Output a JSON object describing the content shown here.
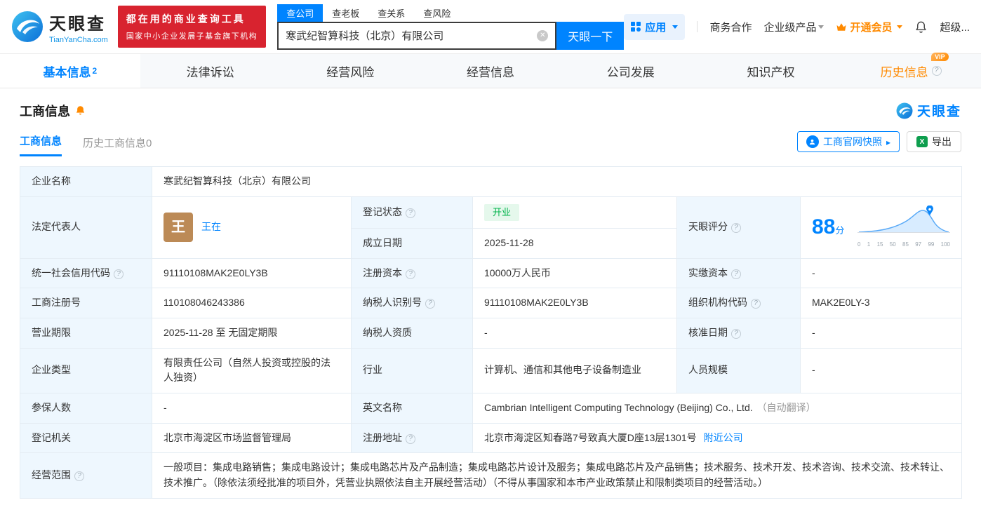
{
  "colors": {
    "primary": "#0084ff",
    "vip_orange": "#ff8a00",
    "promo_red": "#d8232f",
    "status_green": "#00b34a",
    "label_cell_bg": "#eef7fe"
  },
  "header": {
    "logo": {
      "name": "天眼查",
      "domain": "TianYanCha.com"
    },
    "promo": {
      "line1": "都在用的商业查询工具",
      "line2": "国家中小企业发展子基金旗下机构"
    },
    "search": {
      "tabs": [
        {
          "label": "查公司",
          "active": true
        },
        {
          "label": "查老板",
          "active": false
        },
        {
          "label": "查关系",
          "active": false
        },
        {
          "label": "查风险",
          "active": false
        }
      ],
      "value": "寒武纪智算科技（北京）有限公司",
      "button": "天眼一下"
    },
    "nav": {
      "apps": "应用",
      "business": "商务合作",
      "enterprise": "企业级产品",
      "vip": "开通会员",
      "more": "超级..."
    }
  },
  "tabs": [
    {
      "label": "基本信息",
      "badge": "2",
      "active": true
    },
    {
      "label": "法律诉讼",
      "active": false
    },
    {
      "label": "经营风险",
      "active": false
    },
    {
      "label": "经营信息",
      "active": false
    },
    {
      "label": "公司发展",
      "active": false
    },
    {
      "label": "知识产权",
      "active": false
    },
    {
      "label": "历史信息",
      "vip": "VIP",
      "help": true,
      "active": false
    }
  ],
  "section": {
    "title": "工商信息",
    "brand": "天眼查",
    "subtabs": [
      {
        "label": "工商信息",
        "active": true
      },
      {
        "label": "历史工商信息",
        "count": "0",
        "active": false
      }
    ],
    "snapshot_button": "工商官网快照",
    "export_button": "导出"
  },
  "fields": {
    "company_name": {
      "label": "企业名称",
      "value": "寒武纪智算科技（北京）有限公司"
    },
    "legal_rep": {
      "label": "法定代表人",
      "avatar": "王",
      "value": "王在"
    },
    "reg_status": {
      "label": "登记状态",
      "value": "开业"
    },
    "establish_date": {
      "label": "成立日期",
      "value": "2025-11-28"
    },
    "tyc_score": {
      "label": "天眼评分"
    },
    "credit_code": {
      "label": "统一社会信用代码",
      "value": "91110108MAK2E0LY3B"
    },
    "reg_capital": {
      "label": "注册资本",
      "value": "10000万人民币"
    },
    "paid_capital": {
      "label": "实缴资本",
      "value": "-"
    },
    "reg_number": {
      "label": "工商注册号",
      "value": "110108046243386"
    },
    "taxpayer_id": {
      "label": "纳税人识别号",
      "value": "91110108MAK2E0LY3B"
    },
    "org_code": {
      "label": "组织机构代码",
      "value": "MAK2E0LY-3"
    },
    "business_term": {
      "label": "营业期限",
      "value": "2025-11-28 至 无固定期限"
    },
    "taxpayer_qualification": {
      "label": "纳税人资质",
      "value": "-"
    },
    "approval_date": {
      "label": "核准日期",
      "value": "-"
    },
    "company_type": {
      "label": "企业类型",
      "value": "有限责任公司（自然人投资或控股的法人独资）"
    },
    "industry": {
      "label": "行业",
      "value": "计算机、通信和其他电子设备制造业"
    },
    "staff_size": {
      "label": "人员规模",
      "value": "-"
    },
    "insured_count": {
      "label": "参保人数",
      "value": "-"
    },
    "english_name": {
      "label": "英文名称",
      "value": "Cambrian Intelligent Computing Technology (Beijing) Co., Ltd.",
      "note": "（自动翻译）"
    },
    "registry_authority": {
      "label": "登记机关",
      "value": "北京市海淀区市场监督管理局"
    },
    "reg_address": {
      "label": "注册地址",
      "value": "北京市海淀区知春路7号致真大厦D座13层1301号",
      "link": "附近公司"
    },
    "business_scope": {
      "label": "经营范围",
      "value": "一般项目：集成电路销售；集成电路设计；集成电路芯片及产品制造；集成电路芯片设计及服务；集成电路芯片及产品销售；技术服务、技术开发、技术咨询、技术交流、技术转让、技术推广。（除依法须经批准的项目外，凭营业执照依法自主开展经营活动）（不得从事国家和本市产业政策禁止和限制类项目的经营活动。）"
    }
  },
  "score_chart": {
    "score": "88",
    "unit": "分",
    "ticks": [
      "0",
      "1",
      "15",
      "50",
      "85",
      "97",
      "99",
      "100"
    ]
  }
}
